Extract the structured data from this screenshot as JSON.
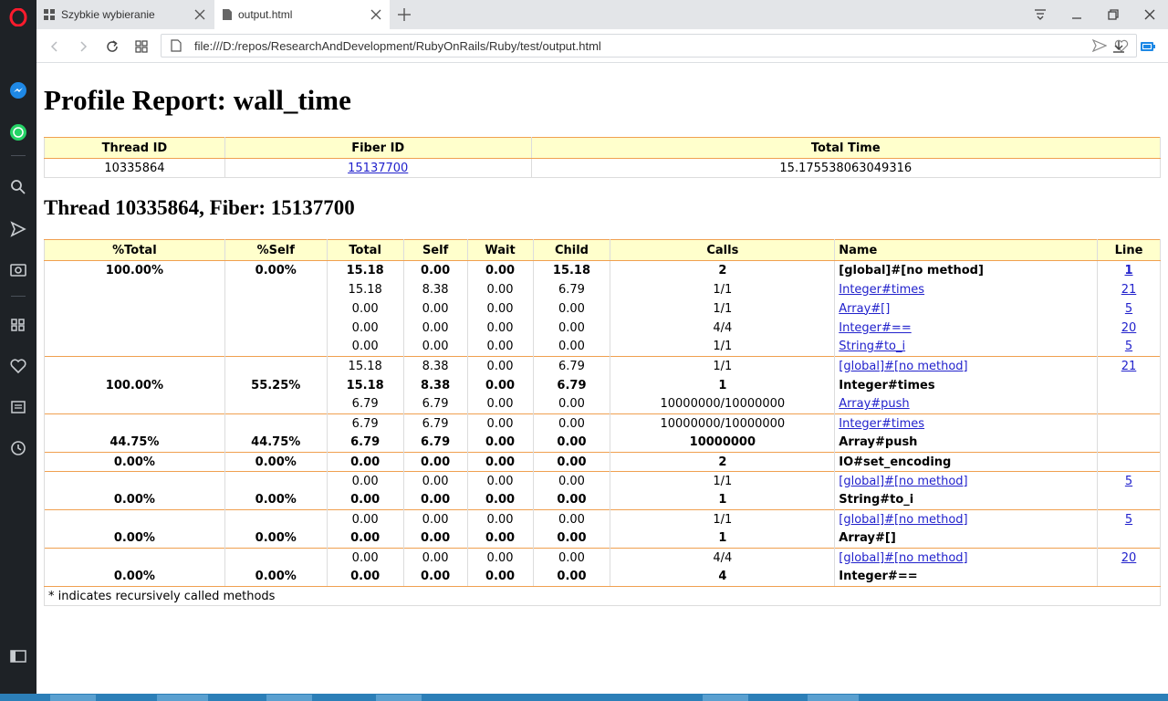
{
  "browser": {
    "tabs": [
      {
        "label": "Szybkie wybieranie"
      },
      {
        "label": "output.html"
      }
    ],
    "url": "file:///D:/repos/ResearchAndDevelopment/RubyOnRails/Ruby/test/output.html"
  },
  "page": {
    "title": "Profile Report: wall_time",
    "summary": {
      "headers": [
        "Thread ID",
        "Fiber ID",
        "Total Time"
      ],
      "thread_id": "10335864",
      "fiber_id": "15137700",
      "total_time": "15.175538063049316"
    },
    "thread_heading": "Thread 10335864, Fiber: 15137700",
    "columns": [
      "%Total",
      "%Self",
      "Total",
      "Self",
      "Wait",
      "Child",
      "Calls",
      "Name",
      "Line"
    ],
    "groups": [
      {
        "rows": [
          {
            "bold": true,
            "total_pct": "100.00%",
            "self_pct": "0.00%",
            "total": "15.18",
            "self": "0.00",
            "wait": "0.00",
            "child": "15.18",
            "calls": "2",
            "name": "[global]#[no method]",
            "name_link": false,
            "line": "1"
          },
          {
            "bold": false,
            "total_pct": "",
            "self_pct": "",
            "total": "15.18",
            "self": "8.38",
            "wait": "0.00",
            "child": "6.79",
            "calls": "1/1",
            "name": "Integer#times",
            "name_link": true,
            "line": "21"
          },
          {
            "bold": false,
            "total_pct": "",
            "self_pct": "",
            "total": "0.00",
            "self": "0.00",
            "wait": "0.00",
            "child": "0.00",
            "calls": "1/1",
            "name": "Array#[]",
            "name_link": true,
            "line": "5"
          },
          {
            "bold": false,
            "total_pct": "",
            "self_pct": "",
            "total": "0.00",
            "self": "0.00",
            "wait": "0.00",
            "child": "0.00",
            "calls": "4/4",
            "name": "Integer#==",
            "name_link": true,
            "line": "20"
          },
          {
            "bold": false,
            "total_pct": "",
            "self_pct": "",
            "total": "0.00",
            "self": "0.00",
            "wait": "0.00",
            "child": "0.00",
            "calls": "1/1",
            "name": "String#to_i",
            "name_link": true,
            "line": "5"
          }
        ]
      },
      {
        "rows": [
          {
            "bold": false,
            "total_pct": "",
            "self_pct": "",
            "total": "15.18",
            "self": "8.38",
            "wait": "0.00",
            "child": "6.79",
            "calls": "1/1",
            "name": "[global]#[no method]",
            "name_link": true,
            "line": "21"
          },
          {
            "bold": true,
            "total_pct": "100.00%",
            "self_pct": "55.25%",
            "total": "15.18",
            "self": "8.38",
            "wait": "0.00",
            "child": "6.79",
            "calls": "1",
            "name": "Integer#times",
            "name_link": false,
            "line": ""
          },
          {
            "bold": false,
            "total_pct": "",
            "self_pct": "",
            "total": "6.79",
            "self": "6.79",
            "wait": "0.00",
            "child": "0.00",
            "calls": "10000000/10000000",
            "name": "Array#push",
            "name_link": true,
            "line": ""
          }
        ]
      },
      {
        "rows": [
          {
            "bold": false,
            "total_pct": "",
            "self_pct": "",
            "total": "6.79",
            "self": "6.79",
            "wait": "0.00",
            "child": "0.00",
            "calls": "10000000/10000000",
            "name": "Integer#times",
            "name_link": true,
            "line": ""
          },
          {
            "bold": true,
            "total_pct": "44.75%",
            "self_pct": "44.75%",
            "total": "6.79",
            "self": "6.79",
            "wait": "0.00",
            "child": "0.00",
            "calls": "10000000",
            "name": "Array#push",
            "name_link": false,
            "line": ""
          }
        ]
      },
      {
        "rows": [
          {
            "bold": true,
            "total_pct": "0.00%",
            "self_pct": "0.00%",
            "total": "0.00",
            "self": "0.00",
            "wait": "0.00",
            "child": "0.00",
            "calls": "2",
            "name": "IO#set_encoding",
            "name_link": false,
            "line": ""
          }
        ]
      },
      {
        "rows": [
          {
            "bold": false,
            "total_pct": "",
            "self_pct": "",
            "total": "0.00",
            "self": "0.00",
            "wait": "0.00",
            "child": "0.00",
            "calls": "1/1",
            "name": "[global]#[no method]",
            "name_link": true,
            "line": "5"
          },
          {
            "bold": true,
            "total_pct": "0.00%",
            "self_pct": "0.00%",
            "total": "0.00",
            "self": "0.00",
            "wait": "0.00",
            "child": "0.00",
            "calls": "1",
            "name": "String#to_i",
            "name_link": false,
            "line": ""
          }
        ]
      },
      {
        "rows": [
          {
            "bold": false,
            "total_pct": "",
            "self_pct": "",
            "total": "0.00",
            "self": "0.00",
            "wait": "0.00",
            "child": "0.00",
            "calls": "1/1",
            "name": "[global]#[no method]",
            "name_link": true,
            "line": "5"
          },
          {
            "bold": true,
            "total_pct": "0.00%",
            "self_pct": "0.00%",
            "total": "0.00",
            "self": "0.00",
            "wait": "0.00",
            "child": "0.00",
            "calls": "1",
            "name": "Array#[]",
            "name_link": false,
            "line": ""
          }
        ]
      },
      {
        "rows": [
          {
            "bold": false,
            "total_pct": "",
            "self_pct": "",
            "total": "0.00",
            "self": "0.00",
            "wait": "0.00",
            "child": "0.00",
            "calls": "4/4",
            "name": "[global]#[no method]",
            "name_link": true,
            "line": "20"
          },
          {
            "bold": true,
            "total_pct": "0.00%",
            "self_pct": "0.00%",
            "total": "0.00",
            "self": "0.00",
            "wait": "0.00",
            "child": "0.00",
            "calls": "4",
            "name": "Integer#==",
            "name_link": false,
            "line": ""
          }
        ]
      }
    ],
    "footnote": "* indicates recursively called methods"
  }
}
